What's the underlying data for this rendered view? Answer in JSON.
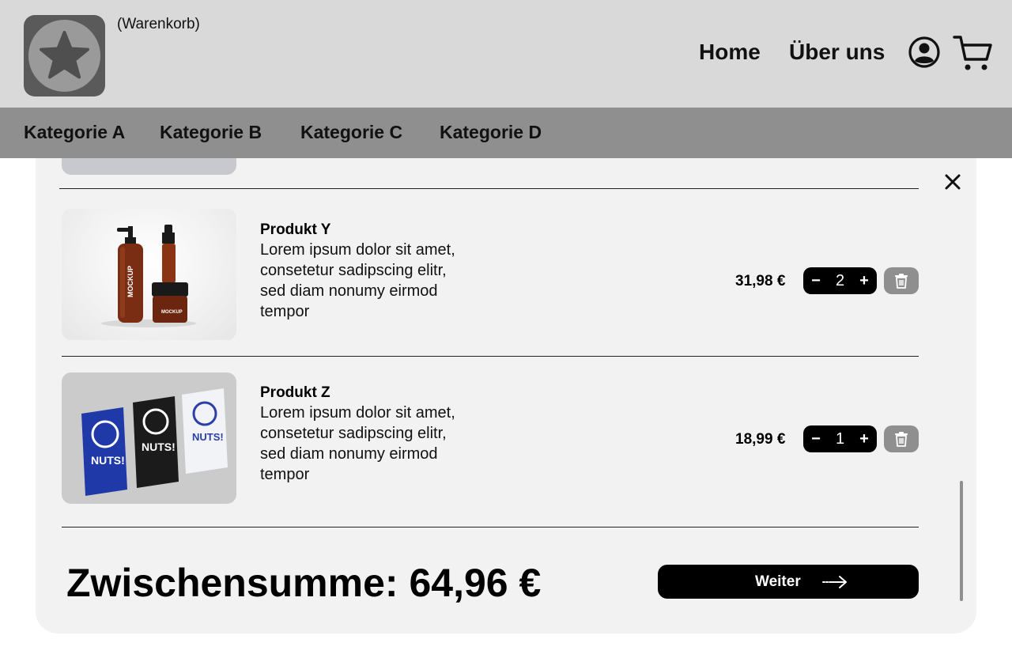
{
  "header": {
    "logo_icon": "star-icon",
    "page_tag": "(Warenkorb)",
    "nav": {
      "home": "Home",
      "about": "Über uns"
    },
    "user_icon": "user-circle-icon",
    "cart_icon": "shopping-cart-icon"
  },
  "categories": [
    "Kategorie A",
    "Kategorie B",
    "Kategorie C",
    "Kategorie D"
  ],
  "cart": {
    "close_icon": "close-icon",
    "items": [
      {
        "name": "Produkt Y",
        "description": "Lorem ipsum dolor sit amet, consetetur sadipscing elitr, sed diam nonumy eirmod tempor",
        "price": "31,98 €",
        "quantity": "2",
        "minus": "−",
        "plus": "+",
        "image": "amber cosmetic bottles mockup",
        "image_text": "MOCKUP"
      },
      {
        "name": "Produkt Z",
        "description": "Lorem ipsum dolor sit amet, consetetur sadipscing elitr, sed diam nonumy eirmod tempor",
        "price": "18,99 €",
        "quantity": "1",
        "minus": "−",
        "plus": "+",
        "image": "NUTS! snack pouches mockup",
        "image_text": "NUTS!"
      }
    ],
    "subtotal": "Zwischensumme: 64,96 €",
    "next_button": "Weiter"
  },
  "colors": {
    "header_bg": "#d9d9d9",
    "category_bar_bg": "#8f8f8f",
    "panel_bg": "#f2f2f2",
    "button_bg": "#000000",
    "trash_bg": "#8f8f8f"
  }
}
